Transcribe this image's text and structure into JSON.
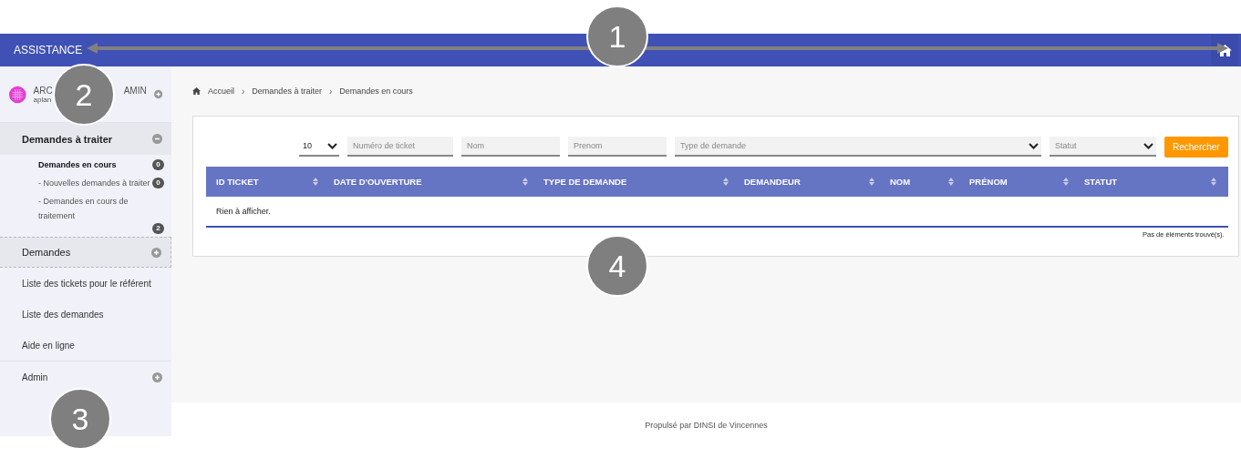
{
  "header": {
    "title": "ASSISTANCE"
  },
  "user": {
    "name_start": "ARC",
    "name_end": "AMIN",
    "login": "aplan"
  },
  "sidebar": {
    "items": [
      {
        "kind": "section",
        "label": "Demandes à traiter",
        "expanded": true,
        "children": [
          {
            "label": "Demandes en cours",
            "count": "0",
            "selected": true
          },
          {
            "label": "- Nouvelles demandes à traiter",
            "count": "0",
            "selected": false
          },
          {
            "label": "- Demandes en cours de traitement",
            "count": "2",
            "selected": false
          }
        ]
      },
      {
        "kind": "section",
        "label": "Demandes",
        "expanded": false
      },
      {
        "kind": "link",
        "label": "Liste des tickets pour le référent"
      },
      {
        "kind": "link",
        "label": "Liste des demandes"
      },
      {
        "kind": "link",
        "label": "Aide en ligne"
      },
      {
        "kind": "section",
        "label": "Admin",
        "expanded": false
      }
    ]
  },
  "breadcrumb": [
    "Accueil",
    "Demandes à traiter",
    "Demandes en cours"
  ],
  "breadcrumb_separator": "›",
  "filters": {
    "page_size": "10",
    "fields": [
      {
        "kind": "input",
        "placeholder": "Numéro de ticket"
      },
      {
        "kind": "input",
        "placeholder": "Nom"
      },
      {
        "kind": "input",
        "placeholder": "Prenom"
      },
      {
        "kind": "select",
        "placeholder": "Type de demande"
      },
      {
        "kind": "select",
        "placeholder": "Statut"
      }
    ],
    "button": "Rechercher"
  },
  "table": {
    "columns": [
      "ID TICKET",
      "DATE D'OUVERTURE",
      "TYPE DE DEMANDE",
      "DEMANDEUR",
      "NOM",
      "PRÉNOM",
      "STATUT"
    ],
    "empty_text": "Rien à afficher.",
    "footer_text": "Pas de éléments trouvé(s)."
  },
  "footer": "Propulsé par DINSI de Vincennes",
  "annotations": [
    "1",
    "2",
    "3",
    "4"
  ]
}
